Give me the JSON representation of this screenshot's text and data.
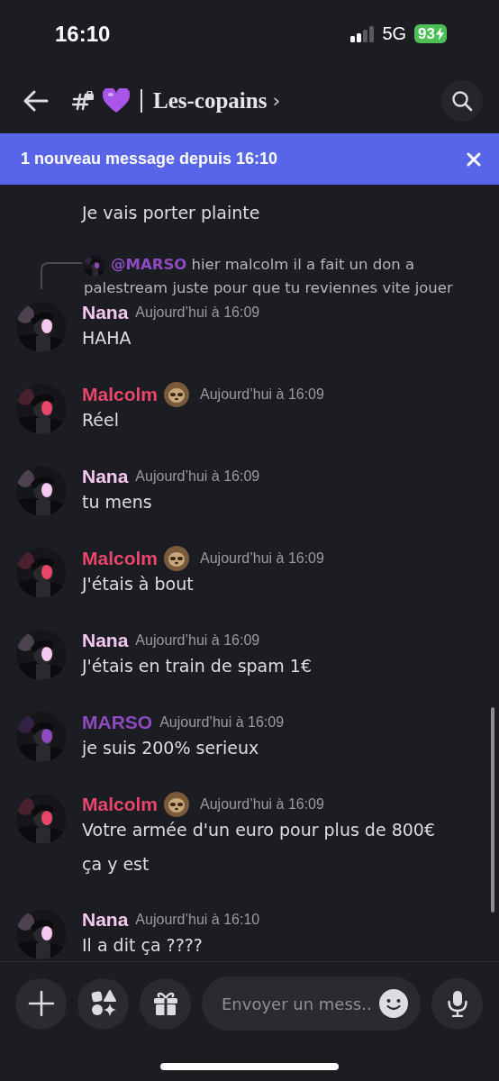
{
  "status_bar": {
    "time": "16:10",
    "network": "5G",
    "battery": "93",
    "charging": true
  },
  "header": {
    "channel": "Les-copains",
    "chevron": "›"
  },
  "banner": {
    "text": "1 nouveau message depuis 16:10"
  },
  "messages": [
    {
      "kind": "continuation",
      "lines": [
        "Je vais porter plainte"
      ]
    },
    {
      "kind": "message",
      "author": "Nana",
      "color": "#f4c8ef",
      "badge": false,
      "time": "Aujourd’hui à 16:09",
      "reply": {
        "mention": "@MARSO",
        "text": "hier malcolm il a fait un don a palestream juste pour que tu reviennes vite jouer"
      },
      "lines": [
        "HAHA"
      ]
    },
    {
      "kind": "message",
      "author": "Malcolm",
      "color": "#e8466b",
      "badge": true,
      "time": "Aujourd’hui à 16:09",
      "lines": [
        "Réel"
      ]
    },
    {
      "kind": "message",
      "author": "Nana",
      "color": "#f4c8ef",
      "badge": false,
      "time": "Aujourd’hui à 16:09",
      "lines": [
        "tu mens"
      ]
    },
    {
      "kind": "message",
      "author": "Malcolm",
      "color": "#e8466b",
      "badge": true,
      "time": "Aujourd’hui à 16:09",
      "lines": [
        "J'étais à bout"
      ]
    },
    {
      "kind": "message",
      "author": "Nana",
      "color": "#f4c8ef",
      "badge": false,
      "time": "Aujourd’hui à 16:09",
      "lines": [
        "J'étais en train de spam 1€"
      ]
    },
    {
      "kind": "message",
      "author": "MARSO",
      "color": "#8e4bbf",
      "badge": false,
      "time": "Aujourd’hui à 16:09",
      "lines": [
        "je suis 200% serieux"
      ]
    },
    {
      "kind": "message",
      "author": "Malcolm",
      "color": "#e8466b",
      "badge": true,
      "time": "Aujourd’hui à 16:09",
      "lines": [
        "Votre armée d'un euro pour plus de 800€",
        "ça y est"
      ]
    },
    {
      "kind": "message",
      "author": "Nana",
      "color": "#f4c8ef",
      "badge": false,
      "time": "Aujourd’hui à 16:10",
      "lines": [
        "Il a dit ça ????"
      ]
    }
  ],
  "composer": {
    "placeholder": "Envoyer un mess.."
  }
}
